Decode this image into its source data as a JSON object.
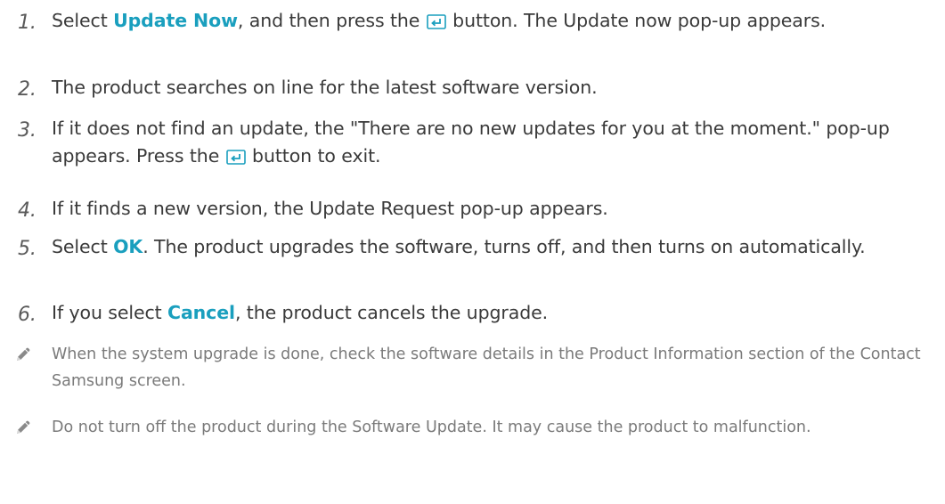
{
  "steps": [
    {
      "num": "1.",
      "parts": {
        "a": "Select ",
        "hl": "Update Now",
        "b": ", and then press the ",
        "c": " button. The Update now pop-up appears."
      }
    },
    {
      "num": "2.",
      "text": "The product searches on line for the latest software version."
    },
    {
      "num": "3.",
      "parts": {
        "a": "If it does not find an update, the \"There are no new updates for you at the moment.\" pop-up appears. Press the ",
        "b": " button to exit."
      }
    },
    {
      "num": "4.",
      "text": "If it finds a new version, the Update Request pop-up appears."
    },
    {
      "num": "5.",
      "parts": {
        "a": "Select ",
        "hl": "OK",
        "b": ". The product upgrades the software, turns off, and then turns on automatically."
      }
    },
    {
      "num": "6.",
      "parts": {
        "a": "If you select ",
        "hl": "Cancel",
        "b": ", the product cancels the upgrade."
      }
    }
  ],
  "notes": [
    "When the system upgrade is done, check the software details in the Product Information section of the Contact Samsung screen.",
    "Do not turn off the product during the Software Update. It may cause the product to malfunction."
  ],
  "colors": {
    "highlight": "#1a9fbe",
    "body_text": "#3a3a3a",
    "note_text": "#7a7a7a"
  },
  "icons": {
    "enter": "enter-button-icon",
    "note": "pencil-note-icon"
  }
}
